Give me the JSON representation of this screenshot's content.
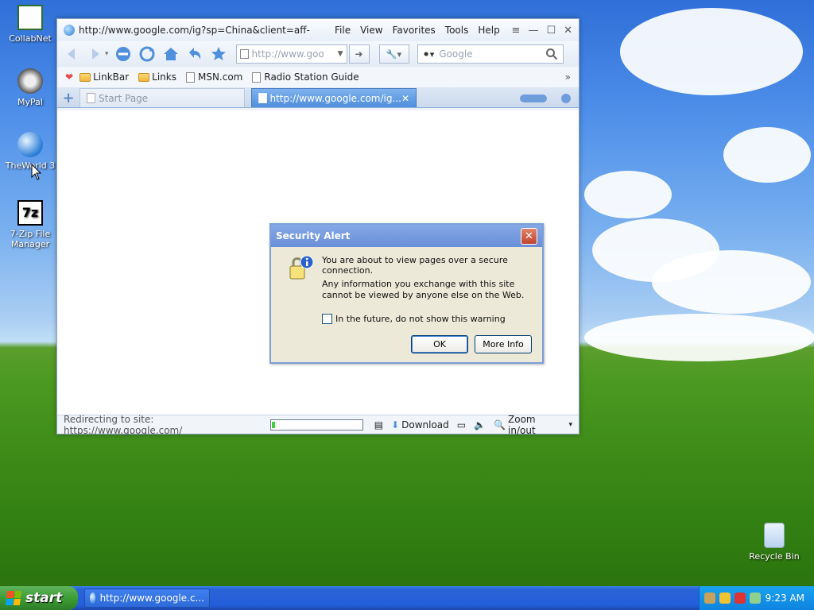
{
  "desktop": {
    "icons": [
      {
        "label": "CollabNet"
      },
      {
        "label": "MyPal"
      },
      {
        "label": "TheWorld 3"
      },
      {
        "label": "7-Zip File Manager"
      },
      {
        "label": "Recycle Bin"
      }
    ]
  },
  "browser": {
    "title": "http://www.google.com/ig?sp=China&client=aff-...",
    "menu": [
      "File",
      "View",
      "Favorites",
      "Tools",
      "Help"
    ],
    "address": "http://www.goo",
    "search_placeholder": "Google",
    "favorites": [
      "LinkBar",
      "Links",
      "MSN.com",
      "Radio Station Guide"
    ],
    "tabs": [
      {
        "label": "Start Page"
      },
      {
        "label": "http://www.google.com/ig..."
      }
    ],
    "status": {
      "text": "Redirecting to site: https://www.google.com/",
      "progress": 0.04,
      "download_label": "Download",
      "zoom_label": "Zoom in/out"
    }
  },
  "dialog": {
    "title": "Security Alert",
    "message1": "You are about to view pages over a secure connection.",
    "message2": "Any information you exchange with this site cannot be viewed by anyone else on the Web.",
    "checkbox_label": "In the future, do not show this warning",
    "ok_label": "OK",
    "more_info_label": "More Info"
  },
  "taskbar": {
    "start_label": "start",
    "task_label": "http://www.google.c...",
    "clock": "9:23 AM"
  }
}
